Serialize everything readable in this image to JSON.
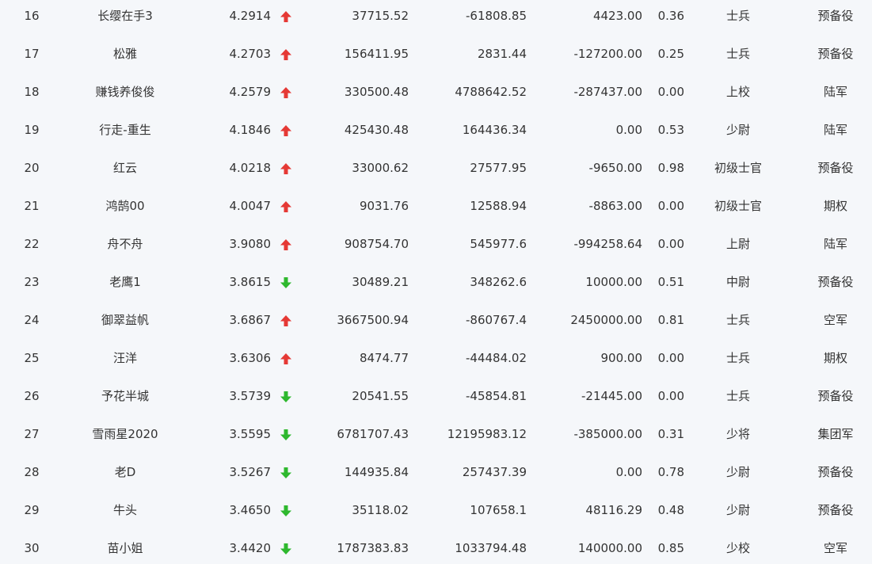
{
  "colors": {
    "up": "#e53935",
    "down": "#2eb82e"
  },
  "rows": [
    {
      "rank": "16",
      "name": "长缨在手3",
      "score": "4.2914",
      "trend": "up",
      "v1": "37715.52",
      "v2": "-61808.85",
      "v3": "4423.00",
      "v4": "0.36",
      "level": "士兵",
      "group": "预备役"
    },
    {
      "rank": "17",
      "name": "松雅",
      "score": "4.2703",
      "trend": "up",
      "v1": "156411.95",
      "v2": "2831.44",
      "v3": "-127200.00",
      "v4": "0.25",
      "level": "士兵",
      "group": "预备役"
    },
    {
      "rank": "18",
      "name": "赚钱养俊俊",
      "score": "4.2579",
      "trend": "up",
      "v1": "330500.48",
      "v2": "4788642.52",
      "v3": "-287437.00",
      "v4": "0.00",
      "level": "上校",
      "group": "陆军"
    },
    {
      "rank": "19",
      "name": "行走-重生",
      "score": "4.1846",
      "trend": "up",
      "v1": "425430.48",
      "v2": "164436.34",
      "v3": "0.00",
      "v4": "0.53",
      "level": "少尉",
      "group": "陆军"
    },
    {
      "rank": "20",
      "name": "红云",
      "score": "4.0218",
      "trend": "up",
      "v1": "33000.62",
      "v2": "27577.95",
      "v3": "-9650.00",
      "v4": "0.98",
      "level": "初级士官",
      "group": "预备役"
    },
    {
      "rank": "21",
      "name": "鸿鹄00",
      "score": "4.0047",
      "trend": "up",
      "v1": "9031.76",
      "v2": "12588.94",
      "v3": "-8863.00",
      "v4": "0.00",
      "level": "初级士官",
      "group": "期权"
    },
    {
      "rank": "22",
      "name": "舟不舟",
      "score": "3.9080",
      "trend": "up",
      "v1": "908754.70",
      "v2": "545977.6",
      "v3": "-994258.64",
      "v4": "0.00",
      "level": "上尉",
      "group": "陆军"
    },
    {
      "rank": "23",
      "name": "老鹰1",
      "score": "3.8615",
      "trend": "down",
      "v1": "30489.21",
      "v2": "348262.6",
      "v3": "10000.00",
      "v4": "0.51",
      "level": "中尉",
      "group": "预备役"
    },
    {
      "rank": "24",
      "name": "御翠益帆",
      "score": "3.6867",
      "trend": "up",
      "v1": "3667500.94",
      "v2": "-860767.4",
      "v3": "2450000.00",
      "v4": "0.81",
      "level": "士兵",
      "group": "空军"
    },
    {
      "rank": "25",
      "name": "汪洋",
      "score": "3.6306",
      "trend": "up",
      "v1": "8474.77",
      "v2": "-44484.02",
      "v3": "900.00",
      "v4": "0.00",
      "level": "士兵",
      "group": "期权"
    },
    {
      "rank": "26",
      "name": "予花半城",
      "score": "3.5739",
      "trend": "down",
      "v1": "20541.55",
      "v2": "-45854.81",
      "v3": "-21445.00",
      "v4": "0.00",
      "level": "士兵",
      "group": "预备役"
    },
    {
      "rank": "27",
      "name": "雪雨星2020",
      "score": "3.5595",
      "trend": "down",
      "v1": "6781707.43",
      "v2": "12195983.12",
      "v3": "-385000.00",
      "v4": "0.31",
      "level": "少将",
      "group": "集团军"
    },
    {
      "rank": "28",
      "name": "老D",
      "score": "3.5267",
      "trend": "down",
      "v1": "144935.84",
      "v2": "257437.39",
      "v3": "0.00",
      "v4": "0.78",
      "level": "少尉",
      "group": "预备役"
    },
    {
      "rank": "29",
      "name": "牛头",
      "score": "3.4650",
      "trend": "down",
      "v1": "35118.02",
      "v2": "107658.1",
      "v3": "48116.29",
      "v4": "0.48",
      "level": "少尉",
      "group": "预备役"
    },
    {
      "rank": "30",
      "name": "苗小姐",
      "score": "3.4420",
      "trend": "down",
      "v1": "1787383.83",
      "v2": "1033794.48",
      "v3": "140000.00",
      "v4": "0.85",
      "level": "少校",
      "group": "空军"
    }
  ]
}
